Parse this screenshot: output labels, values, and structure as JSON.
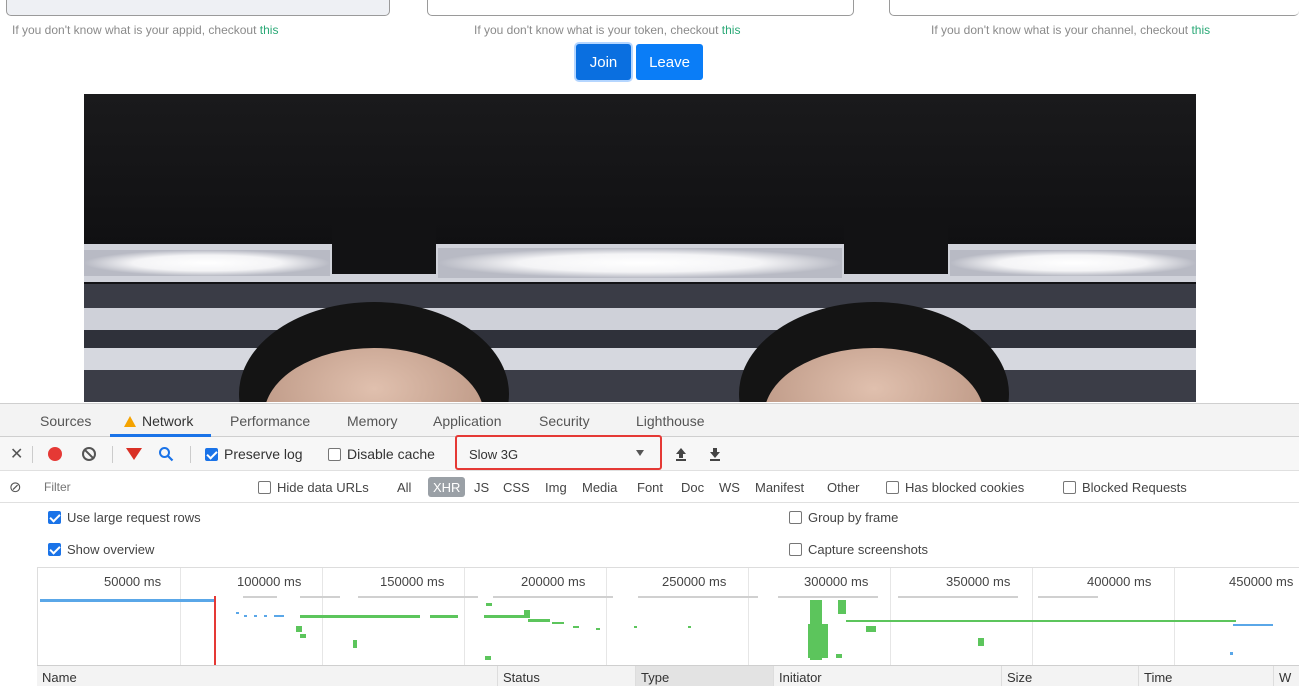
{
  "page": {
    "help": [
      {
        "prefix": "If you don't know what is your appid, checkout ",
        "link": "this"
      },
      {
        "prefix": "If you don't know what is your token, checkout ",
        "link": "this"
      },
      {
        "prefix": "If you don't know what is your channel, checkout ",
        "link": "this"
      }
    ],
    "join_label": "Join",
    "leave_label": "Leave"
  },
  "devtools": {
    "tabs": [
      {
        "label": "Sources"
      },
      {
        "label": "Network",
        "active": true,
        "icon": "warning-icon"
      },
      {
        "label": "Performance"
      },
      {
        "label": "Memory"
      },
      {
        "label": "Application"
      },
      {
        "label": "Security"
      },
      {
        "label": "Lighthouse"
      }
    ],
    "toolbar": {
      "preserve_log": "Preserve log",
      "preserve_log_checked": true,
      "disable_cache": "Disable cache",
      "disable_cache_checked": false,
      "throttle_value": "Slow 3G"
    },
    "filter": {
      "placeholder": "Filter",
      "hide_data_urls": "Hide data URLs",
      "types": [
        "All",
        "XHR",
        "JS",
        "CSS",
        "Img",
        "Media",
        "Font",
        "Doc",
        "WS",
        "Manifest",
        "Other"
      ],
      "active_type": "XHR",
      "has_blocked_cookies": "Has blocked cookies",
      "blocked_requests": "Blocked Requests"
    },
    "options": {
      "use_large_rows": "Use large request rows",
      "show_overview": "Show overview",
      "group_by_frame": "Group by frame",
      "capture_screenshots": "Capture screenshots"
    },
    "overview": {
      "ticks": [
        "50000 ms",
        "100000 ms",
        "150000 ms",
        "200000 ms",
        "250000 ms",
        "300000 ms",
        "350000 ms",
        "400000 ms",
        "450000 ms"
      ]
    },
    "columns": [
      "Name",
      "Status",
      "Type",
      "Initiator",
      "Size",
      "Time",
      "W"
    ],
    "colors": {
      "accent": "#1a73e8",
      "record": "#e53935",
      "filter_icon": "#d93025",
      "waterfall_green": "#5cc55c",
      "waterfall_blue": "#5aa7e8",
      "highlight": "#e53935"
    }
  }
}
